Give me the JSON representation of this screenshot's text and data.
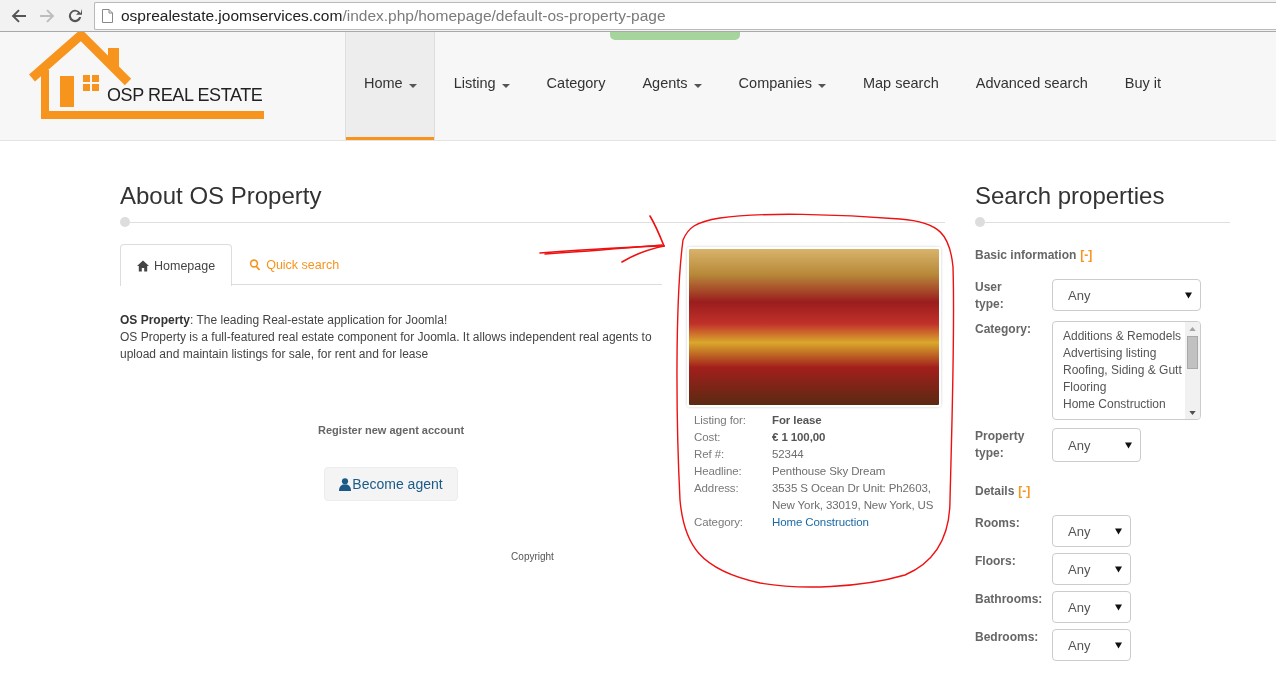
{
  "browser": {
    "nav_buttons": [
      {
        "kind": "back",
        "disabled": false
      },
      {
        "kind": "forward",
        "disabled": true
      },
      {
        "kind": "reload",
        "disabled": false
      }
    ],
    "url": {
      "host": "osprealestate.joomservices.com",
      "path": "/index.php/homepage/default-os-property-page"
    }
  },
  "header": {
    "logo_text": "OSP REAL ESTATE",
    "nav": [
      {
        "label": "Home",
        "dropdown": true,
        "selected": true
      },
      {
        "label": "Listing",
        "dropdown": true,
        "selected": false
      },
      {
        "label": "Category",
        "dropdown": false,
        "selected": false
      },
      {
        "label": "Agents",
        "dropdown": true,
        "selected": false
      },
      {
        "label": "Companies",
        "dropdown": true,
        "selected": false
      },
      {
        "label": "Map search",
        "dropdown": false,
        "selected": false
      },
      {
        "label": "Advanced search",
        "dropdown": false,
        "selected": false
      },
      {
        "label": "Buy it",
        "dropdown": false,
        "selected": false
      }
    ]
  },
  "about": {
    "title": "About OS Property",
    "tabs": [
      {
        "kind": "home",
        "label": "Homepage",
        "selected": true
      },
      {
        "kind": "search",
        "label": "Quick search",
        "selected": false
      }
    ],
    "intro": [
      "**OS Property**: The leading Real-estate application for Joomla!",
      "OS Property is a full-featured real estate component for Joomla. It allows independent real agents to upload and maintain listings for sale, for rent and for lease"
    ],
    "register_label": "Register new agent account",
    "become_agent_button": "Become agent",
    "copyright": "Copyright"
  },
  "property_card": {
    "details": [
      {
        "label": "Listing for:",
        "value": "For lease",
        "kind": "bold"
      },
      {
        "label": "Cost:",
        "value": "€ 1 100,00",
        "kind": "bold"
      },
      {
        "label": "Ref #:",
        "value": "52344",
        "kind": "plain"
      },
      {
        "label": "Headline:",
        "value": "Penthouse Sky Dream",
        "kind": "plain"
      },
      {
        "label": "Address:",
        "value": "3535 S Ocean Dr Unit: Ph2603, New York, 33019, New York, US",
        "kind": "plain"
      },
      {
        "label": "Category:",
        "value": "Home Construction",
        "kind": "link"
      }
    ]
  },
  "search": {
    "title": "Search properties",
    "sections": [
      {
        "heading": "Basic information",
        "toggle": "[-]",
        "fields": [
          {
            "kind": "select",
            "label": "User type:",
            "value": "Any"
          },
          {
            "kind": "listbox",
            "label": "Category:",
            "options": [
              {
                "label": "Additions & Remodels",
                "selected": false
              },
              {
                "label": "Advertising listing",
                "selected": false
              },
              {
                "label": "Roofing, Siding & Gutt",
                "selected": false
              },
              {
                "label": "Flooring",
                "selected": false
              },
              {
                "label": "Home Construction",
                "selected": false
              }
            ]
          },
          {
            "kind": "select",
            "label": "Property type:",
            "value": "Any"
          }
        ]
      },
      {
        "heading": "Details",
        "toggle": "[-]",
        "fields": [
          {
            "kind": "select",
            "label": "Rooms:",
            "value": "Any"
          },
          {
            "kind": "select",
            "label": "Floors:",
            "value": "Any"
          },
          {
            "kind": "select",
            "label": "Bathrooms:",
            "value": "Any"
          },
          {
            "kind": "select",
            "label": "Bedrooms:",
            "value": "Any"
          }
        ]
      }
    ]
  },
  "annotations": {
    "arrow": true,
    "circle": true
  }
}
